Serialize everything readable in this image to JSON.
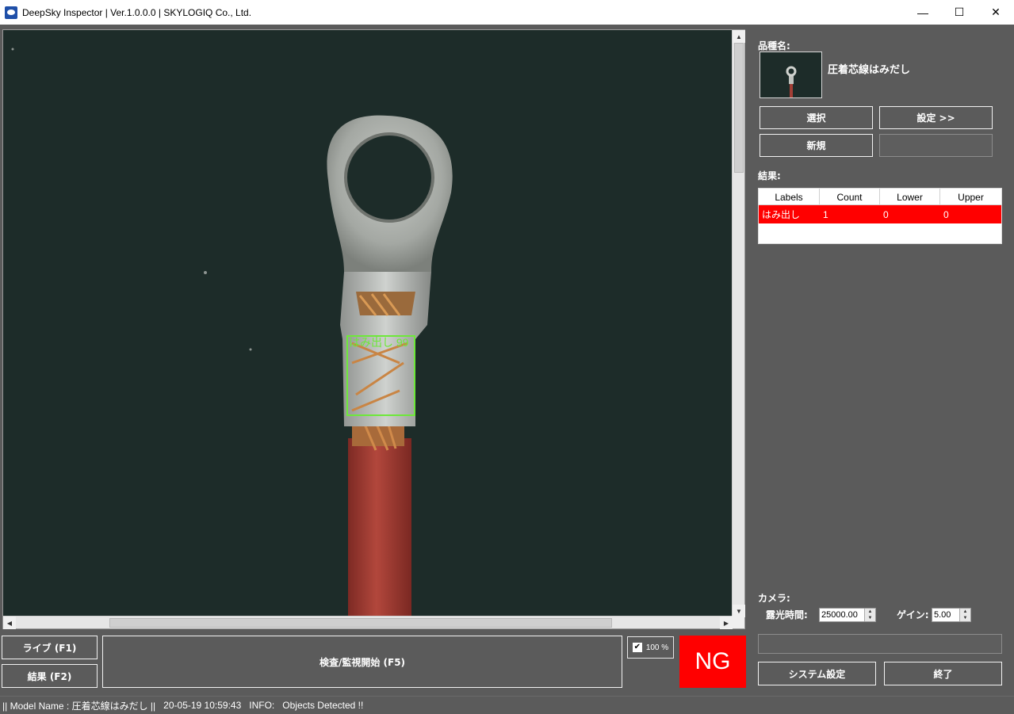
{
  "window": {
    "title": "DeepSky Inspector | Ver.1.0.0.0 | SKYLOGIQ Co., Ltd.",
    "minimize_glyph": "—",
    "maximize_glyph": "☐",
    "close_glyph": "✕"
  },
  "viewer": {
    "detection_label": "はみ出し 99",
    "box_color": "#6ee83a",
    "background_color": "#1d2c29"
  },
  "buttons": {
    "live": "ライブ (F1)",
    "results": "結果 (F2)",
    "inspect": "検査/監視開始 (F5)",
    "select": "選択",
    "settings": "設定 >>",
    "new": "新規",
    "system_settings": "システム設定",
    "exit": "終了"
  },
  "zoom_check": {
    "checked": true,
    "label": "100 %"
  },
  "verdict": {
    "text": "NG",
    "color": "#ff0000"
  },
  "status_bar": {
    "model": "|| Model Name : 圧着芯線はみだし ||",
    "timestamp": "20-05-19 10:59:43",
    "info_label": "INFO:",
    "info_text": "Objects Detected !!"
  },
  "panel": {
    "product_label": "品種名:",
    "product_name": "圧着芯線はみだし",
    "result_label": "結果:",
    "camera_label": "カメラ:",
    "exposure_label": "露光時間:",
    "exposure_value": "25000.00",
    "gain_label": "ゲイン:",
    "gain_value": "5.00"
  },
  "result_table": {
    "headers": [
      "Labels",
      "Count",
      "Lower",
      "Upper"
    ],
    "rows": [
      {
        "label": "はみ出し",
        "count": "1",
        "lower": "0",
        "upper": "0",
        "status_color": "#ff0000"
      }
    ]
  }
}
